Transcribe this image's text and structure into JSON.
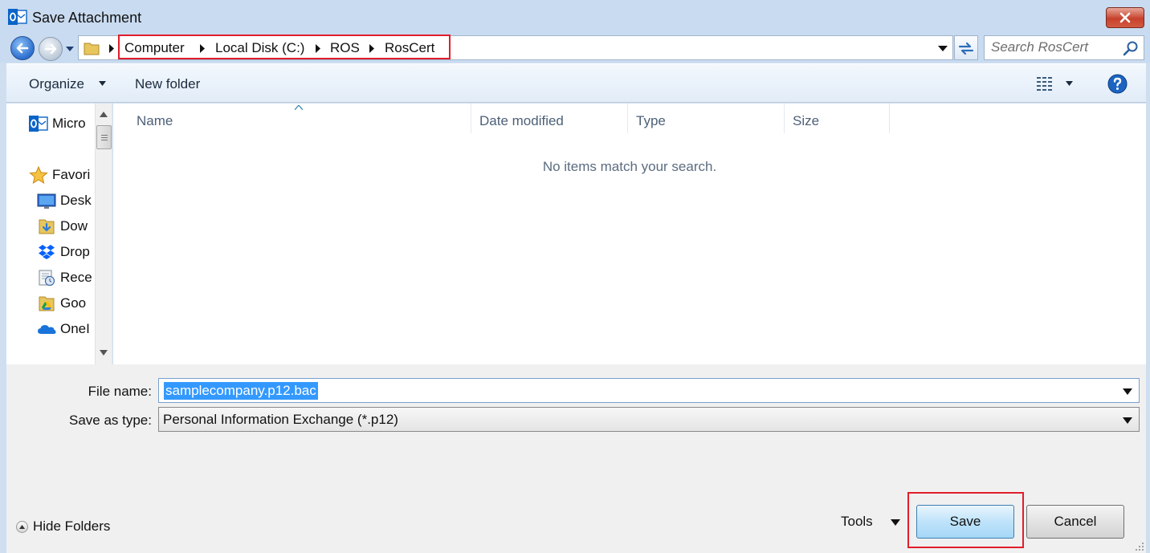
{
  "window": {
    "title": "Save Attachment"
  },
  "address": {
    "crumbs": [
      "Computer",
      "Local Disk (C:)",
      "ROS",
      "RosCert"
    ],
    "search_placeholder": "Search RosCert"
  },
  "toolbar": {
    "organize_label": "Organize",
    "new_folder_label": "New folder"
  },
  "nav": {
    "items": [
      {
        "label": "Micro",
        "icon": "outlook-icon"
      },
      {
        "label": "Favori",
        "icon": "star-icon"
      },
      {
        "label": "Desk",
        "icon": "desktop-icon"
      },
      {
        "label": "Dow",
        "icon": "downloads-folder-icon"
      },
      {
        "label": "Drop",
        "icon": "dropbox-icon"
      },
      {
        "label": "Rece",
        "icon": "recent-places-icon"
      },
      {
        "label": "Goo",
        "icon": "google-drive-folder-icon"
      },
      {
        "label": "OneI",
        "icon": "onedrive-icon"
      }
    ]
  },
  "files": {
    "columns": [
      "Name",
      "Date modified",
      "Type",
      "Size"
    ],
    "empty_message": "No items match your search."
  },
  "form": {
    "file_name_label": "File name:",
    "file_name_value": "samplecompany.p12.bac",
    "save_type_label": "Save as type:",
    "save_type_value": "Personal Information Exchange (*.p12)"
  },
  "footer": {
    "hide_folders_label": "Hide Folders",
    "tools_label": "Tools",
    "save_label": "Save",
    "cancel_label": "Cancel"
  },
  "colors": {
    "highlight_box": "#e01e2a",
    "selection": "#3399ff",
    "accent": "#2c6ed0"
  }
}
